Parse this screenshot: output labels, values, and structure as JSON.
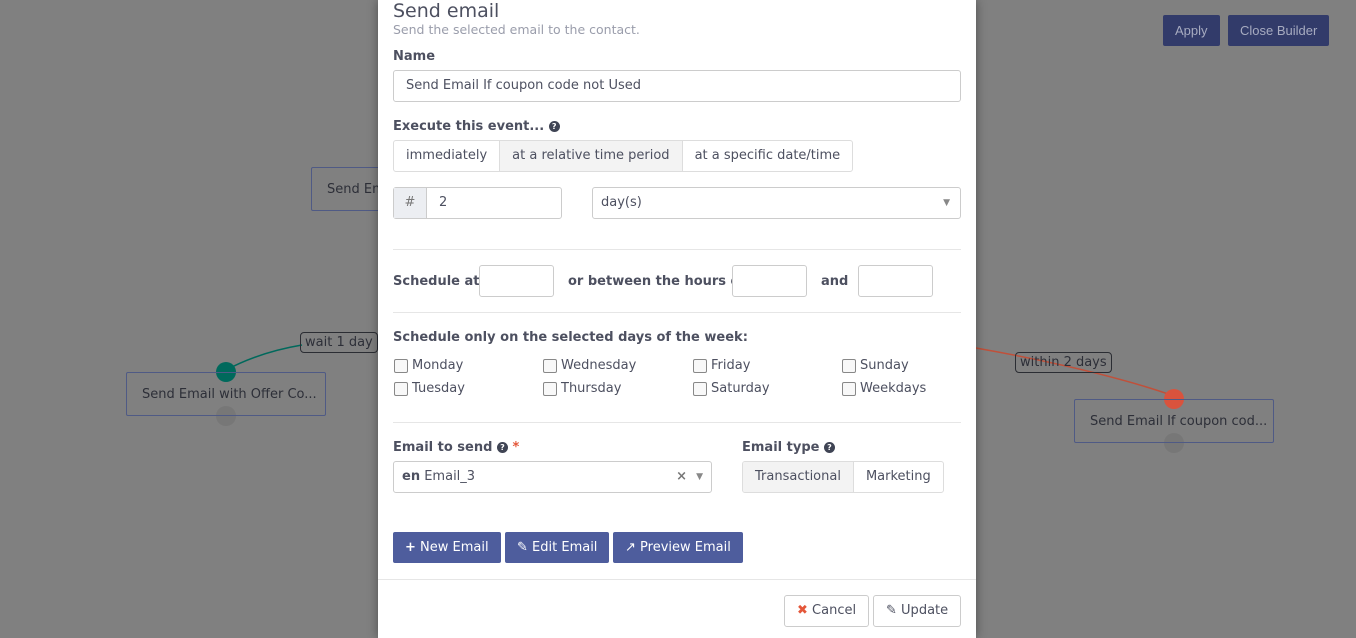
{
  "canvas": {
    "nodes": [
      "Send Em",
      "Send Email with Offer Co...",
      "Send Email If coupon cod..."
    ],
    "edges": [
      "wait 1 day",
      "within 2 days"
    ],
    "apply": "Apply",
    "close_builder": "Close Builder"
  },
  "modal": {
    "title": "Send email",
    "subtitle": "Send the selected email to the contact.",
    "name_label": "Name",
    "name_value": "Send Email If coupon code not Used",
    "execute_label": "Execute this event...",
    "execute_options": [
      "immediately",
      "at a relative time period",
      "at a specific date/time"
    ],
    "execute_selected": "at a relative time period",
    "interval_addon": "#",
    "interval_value": "2",
    "interval_unit": "day(s)",
    "schedule_at": "Schedule at",
    "between_hours": "or between the hours of",
    "and": "and",
    "days_label": "Schedule only on the selected days of the week:",
    "days": [
      "Monday",
      "Tuesday",
      "Wednesday",
      "Thursday",
      "Friday",
      "Saturday",
      "Sunday",
      "Weekdays"
    ],
    "email_label": "Email to send",
    "required": "*",
    "email_lang": "en",
    "email_value": "Email_3",
    "type_label": "Email type",
    "type_options": [
      "Transactional",
      "Marketing"
    ],
    "type_selected": "Transactional",
    "new_email": "New Email",
    "edit_email": "Edit Email",
    "preview_email": "Preview Email",
    "cancel": "Cancel",
    "update": "Update"
  },
  "colors": {
    "primary": "#4e5d9d",
    "cancel_icon": "#e4573a",
    "node_green": "#00695c",
    "node_red": "#d9533d"
  }
}
